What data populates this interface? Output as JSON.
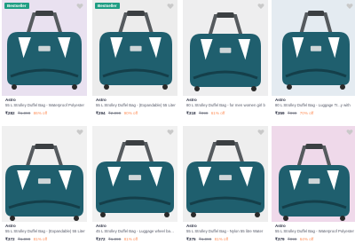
{
  "products": [
    {
      "badge": "Bestseller",
      "brand": "Astro",
      "title": "55 L Strolley Duffel Bag - Waterproof Polyester",
      "price": "₹282",
      "mrp": "₹1,999",
      "discount": "86% off",
      "bg": "#e9e1f0",
      "icon": "heart-icon"
    },
    {
      "badge": "Bestseller",
      "brand": "Astro",
      "title": "55 L Strolley Duffel Bag - (Expandable) 55 Liter",
      "price": "₹294",
      "mrp": "₹2,999",
      "discount": "90% off",
      "bg": "#ececec",
      "icon": "heart-icon"
    },
    {
      "badge": "",
      "brand": "Astro",
      "title": "80 L Strolley Duffel Bag - for men women girl b",
      "price": "₹318",
      "mrp": "₹999",
      "discount": "61% off",
      "bg": "#eeeeef",
      "icon": "heart-icon"
    },
    {
      "badge": "",
      "brand": "Astro",
      "title": "80 L Strolley Duffel Bag - Luggage Tr...y with",
      "price": "₹359",
      "mrp": "₹999",
      "discount": "70% off",
      "bg": "#e4ebf1",
      "icon": "heart-icon"
    },
    {
      "badge": "",
      "brand": "Astro",
      "title": "55 L Strolley Duffel Bag - (Expandable) 55 Liter",
      "price": "₹372",
      "mrp": "₹1,999",
      "discount": "81% off",
      "bg": "#f0f0f0",
      "icon": "heart-icon"
    },
    {
      "badge": "",
      "brand": "Astro",
      "title": "45 L Strolley Duffel Bag - Luggage wheel bag P",
      "price": "₹372",
      "mrp": "₹1,999",
      "discount": "81% off",
      "bg": "#f1f1f1",
      "icon": "heart-icon"
    },
    {
      "badge": "",
      "brand": "Astro",
      "title": "55 L Strolley Duffel Bag - Nylon 55 litre Water",
      "price": "₹375",
      "mrp": "₹1,999",
      "discount": "81% off",
      "bg": "#eeeeee",
      "icon": "heart-icon"
    },
    {
      "badge": "",
      "brand": "Astro",
      "title": "55 L Strolley Duffel Bag - Waterproof Polyester",
      "price": "₹379",
      "mrp": "₹999",
      "discount": "64% off",
      "bg": "#efd9ea",
      "icon": "heart-icon"
    }
  ],
  "colors": {
    "bag": "#1f5f6e",
    "bag_dark": "#143f4a",
    "accent": "#ffffff",
    "strap": "#555a5e"
  }
}
